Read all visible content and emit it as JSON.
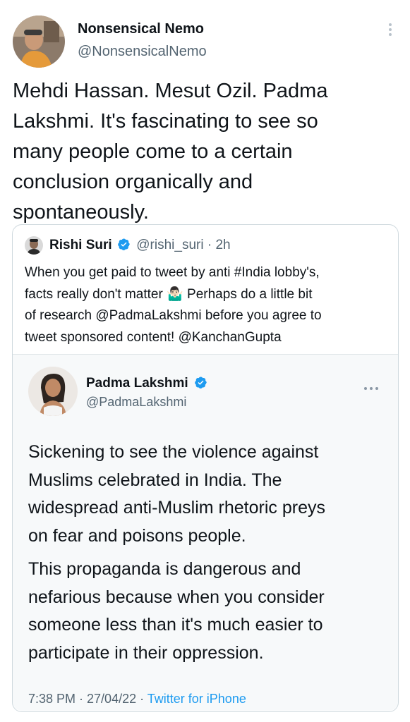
{
  "main_tweet": {
    "display_name": "Nonsensical Nemo",
    "handle": "@NonsensicalNemo",
    "lines": [
      "Mehdi Hassan. Mesut Ozil. Padma",
      "Lakshmi. It's fascinating to see so",
      "many people come to a certain",
      "conclusion organically and",
      "spontaneously."
    ]
  },
  "quoted_tweet": {
    "display_name": "Rishi Suri",
    "handle": "@rishi_suri",
    "separator": "·",
    "time": "2h",
    "lines": [
      "When you get paid to tweet by anti #India lobby's,",
      "facts really don't matter 🤷🏻‍♂️ Perhaps do a little bit",
      "of research @PadmaLakshmi before you agree to",
      "tweet sponsored content! @KanchanGupta"
    ]
  },
  "embedded_tweet": {
    "display_name": "Padma Lakshmi",
    "handle": "@PadmaLakshmi",
    "paragraph1": [
      "Sickening to see the violence against",
      "Muslims celebrated in India. The",
      "widespread anti-Muslim rhetoric preys",
      "on fear and poisons people."
    ],
    "paragraph2": [
      "This propaganda is dangerous and",
      "nefarious because when you consider",
      "someone less than it's much easier to",
      "participate in their oppression."
    ],
    "timestamp": "7:38 PM · 27/04/22 · ",
    "source": "Twitter for iPhone"
  },
  "colors": {
    "link": "#1d9bf0",
    "muted": "#536471",
    "verified": "#1d9bf0"
  }
}
